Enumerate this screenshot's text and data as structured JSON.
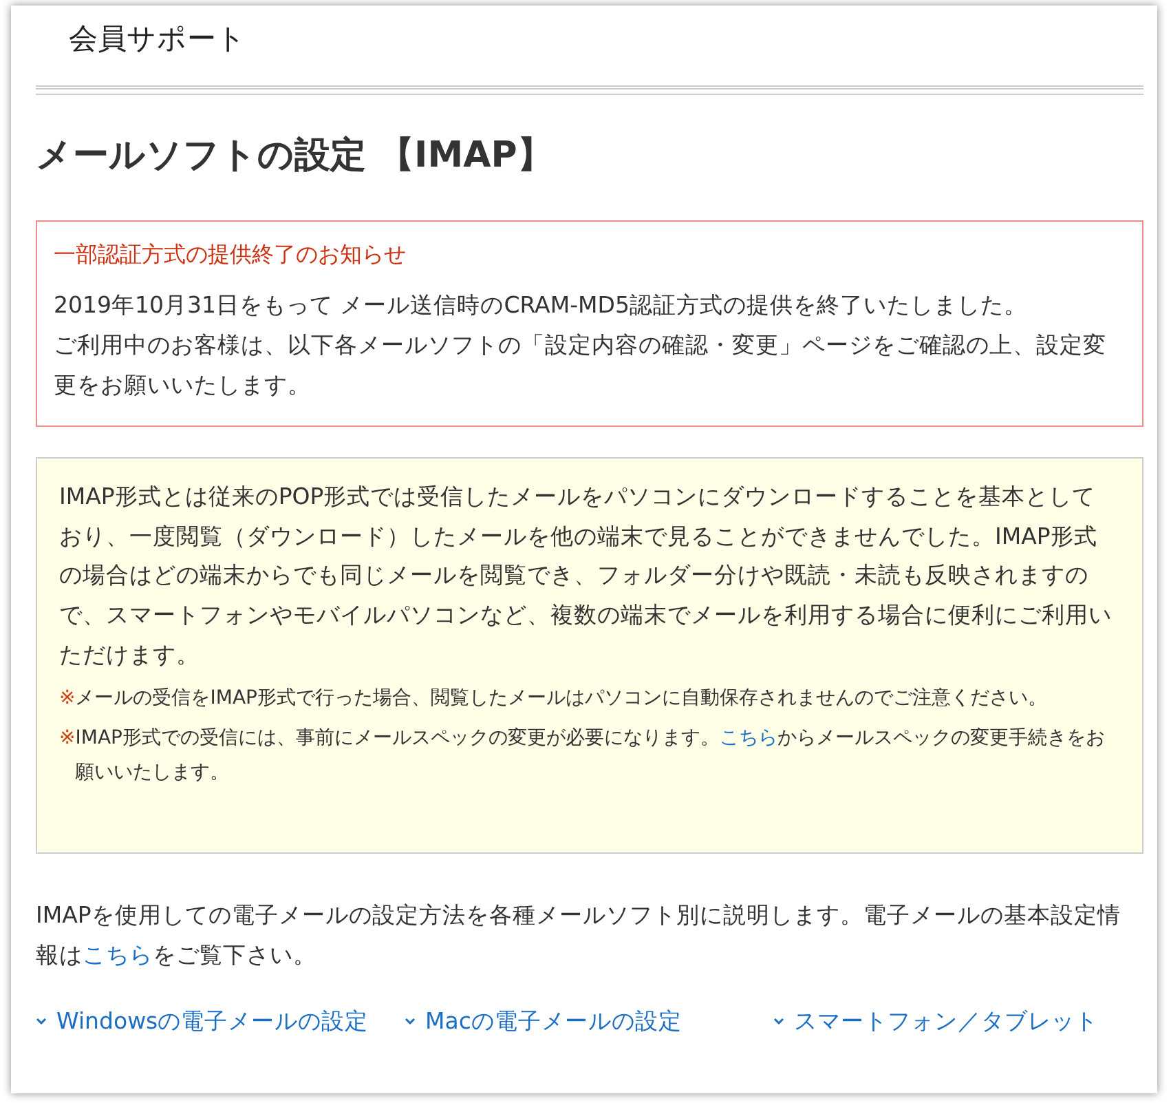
{
  "header": {
    "title": "会員サポート"
  },
  "page_title": "メールソフトの設定 【IMAP】",
  "notice": {
    "title": "一部認証方式の提供終了のお知らせ",
    "paragraphs": [
      "2019年10月31日をもって メール送信時のCRAM-MD5認証方式の提供を終了いたしました。",
      "ご利用中のお客様は、以下各メールソフトの「設定内容の確認・変更」ページをご確認の上、設定変更をお願いいたします。"
    ]
  },
  "info": {
    "text": "IMAP形式とは従来のPOP形式では受信したメールをパソコンにダウンロードすることを基本としており、一度閲覧（ダウンロード）したメールを他の端末で見ることができませんでした。IMAP形式の場合はどの端末からでも同じメールを閲覧でき、フォルダー分けや既読・未読も反映されますので、スマートフォンやモバイルパソコンなど、複数の端末でメールを利用する場合に便利にご利用いただけます。",
    "notes": [
      {
        "mark": "※",
        "before": "メールの受信をIMAP形式で行った場合、閲覧したメールはパソコンに自動保存されませんのでご注意ください。"
      },
      {
        "mark": "※",
        "before": "IMAP形式での受信には、事前にメールスペックの変更が必要になります。",
        "link": "こちら",
        "after": "からメールスペックの変更手続きをお願いいたします。"
      }
    ]
  },
  "intro": {
    "before": "IMAPを使用しての電子メールの設定方法を各種メールソフト別に説明します。電子メールの基本設定情報は",
    "link": "こちら",
    "after": "をご覧下さい。"
  },
  "links": [
    "Windowsの電子メールの設定",
    "Macの電子メールの設定",
    "スマートフォン／タブレット"
  ]
}
